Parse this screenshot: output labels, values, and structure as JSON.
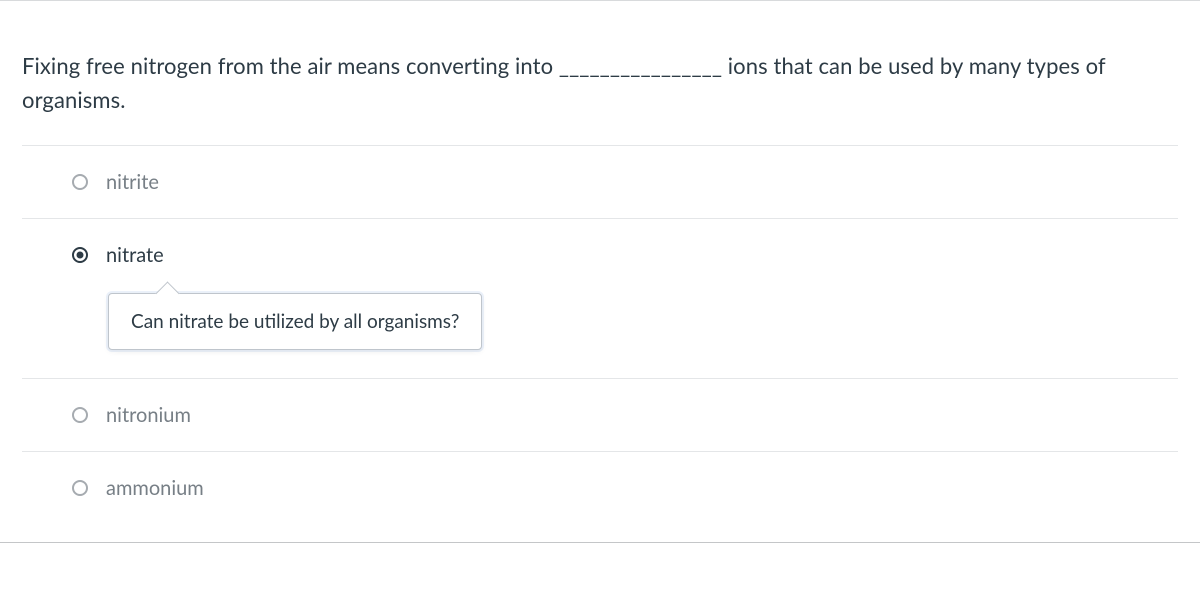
{
  "question": {
    "text": "Fixing free nitrogen from the air means converting into ________________ ions that can be used by many types of organisms."
  },
  "options": [
    {
      "label": "nitrite",
      "selected": false
    },
    {
      "label": "nitrate",
      "selected": true,
      "feedback": "Can nitrate be utilized by all organisms?"
    },
    {
      "label": "nitronium",
      "selected": false
    },
    {
      "label": "ammonium",
      "selected": false
    }
  ]
}
